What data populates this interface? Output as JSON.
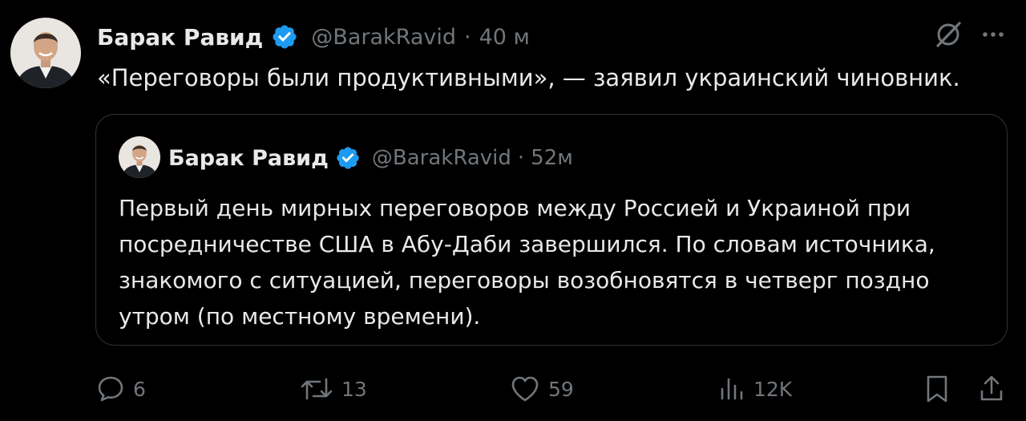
{
  "tweet": {
    "author": {
      "display_name": "Барак Равид",
      "handle": "@BarakRavid",
      "verified": true
    },
    "separator": "·",
    "time": "40 м",
    "text": "«Переговоры были продуктивными», — заявил украинский чиновник."
  },
  "quoted_tweet": {
    "author": {
      "display_name": "Барак Равид",
      "handle": "@BarakRavid",
      "verified": true
    },
    "separator": "·",
    "time": "52м",
    "text": "Первый день мирных переговоров между Россией и Украиной при посредничестве США в Абу-Даби завершился. По словам источника, знакомого с ситуацией, переговоры возобновятся в четверг поздно утром (по местному времени)."
  },
  "actions": {
    "replies": "6",
    "retweets": "13",
    "likes": "59",
    "views": "12K"
  },
  "icons": {
    "grok": "grok-slash-icon",
    "more": "more-dots-icon",
    "verified": "verified-badge-icon",
    "reply": "reply-icon",
    "retweet": "retweet-icon",
    "like": "heart-icon",
    "views": "views-bar-chart-icon",
    "bookmark": "bookmark-icon",
    "share": "share-icon"
  },
  "colors": {
    "background": "#000000",
    "text": "#e7e9ea",
    "secondary": "#71767b",
    "verified": "#1d9bf0",
    "border": "#2f3336"
  }
}
